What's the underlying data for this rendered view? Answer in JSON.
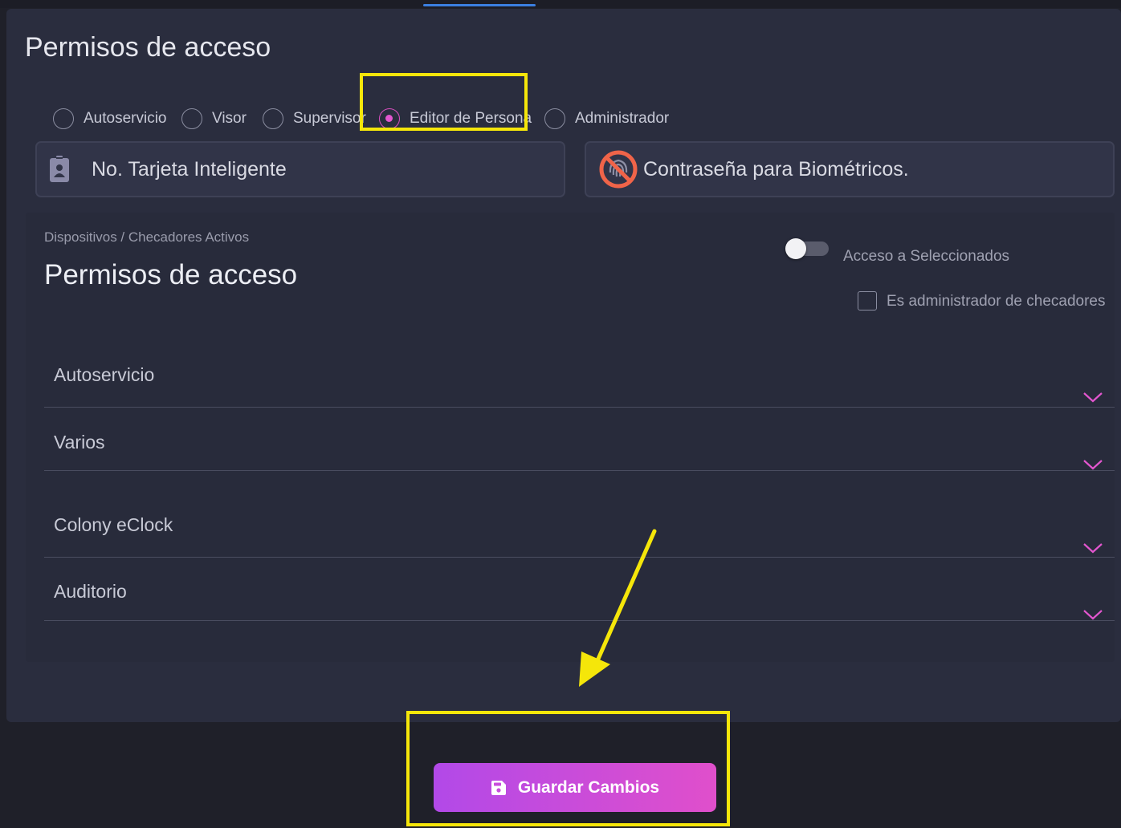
{
  "page": {
    "title": "Permisos de acceso"
  },
  "roles": [
    {
      "label": "Autoservicio",
      "checked": false
    },
    {
      "label": "Visor",
      "checked": false
    },
    {
      "label": "Supervisor",
      "checked": false
    },
    {
      "label": "Editor de Persona",
      "checked": true
    },
    {
      "label": "Administrador",
      "checked": false
    }
  ],
  "fields": {
    "card": {
      "label": "No. Tarjeta Inteligente",
      "icon": "badge-icon"
    },
    "biometric": {
      "label": "Contraseña para Biométricos.",
      "icon": "fingerprint-disabled-icon"
    }
  },
  "devices": {
    "breadcrumb": "Dispositivos / Checadores Activos",
    "title": "Permisos de acceso",
    "toggle_label": "Acceso a Seleccionados",
    "toggle_on": false,
    "checkbox_label": "Es administrador de checadores",
    "checkbox_checked": false,
    "sections": [
      {
        "label": "Autoservicio"
      },
      {
        "label": "Varios"
      },
      {
        "label": "Colony eClock"
      },
      {
        "label": "Auditorio"
      }
    ]
  },
  "footer": {
    "save_label": "Guardar Cambios",
    "save_icon": "save-icon"
  },
  "colors": {
    "accent": "#e356cf",
    "button_gradient_start": "#b249e8",
    "button_gradient_end": "#e04fcb",
    "annotation": "#f5e60a",
    "panel_background": "#2a2d3e"
  }
}
